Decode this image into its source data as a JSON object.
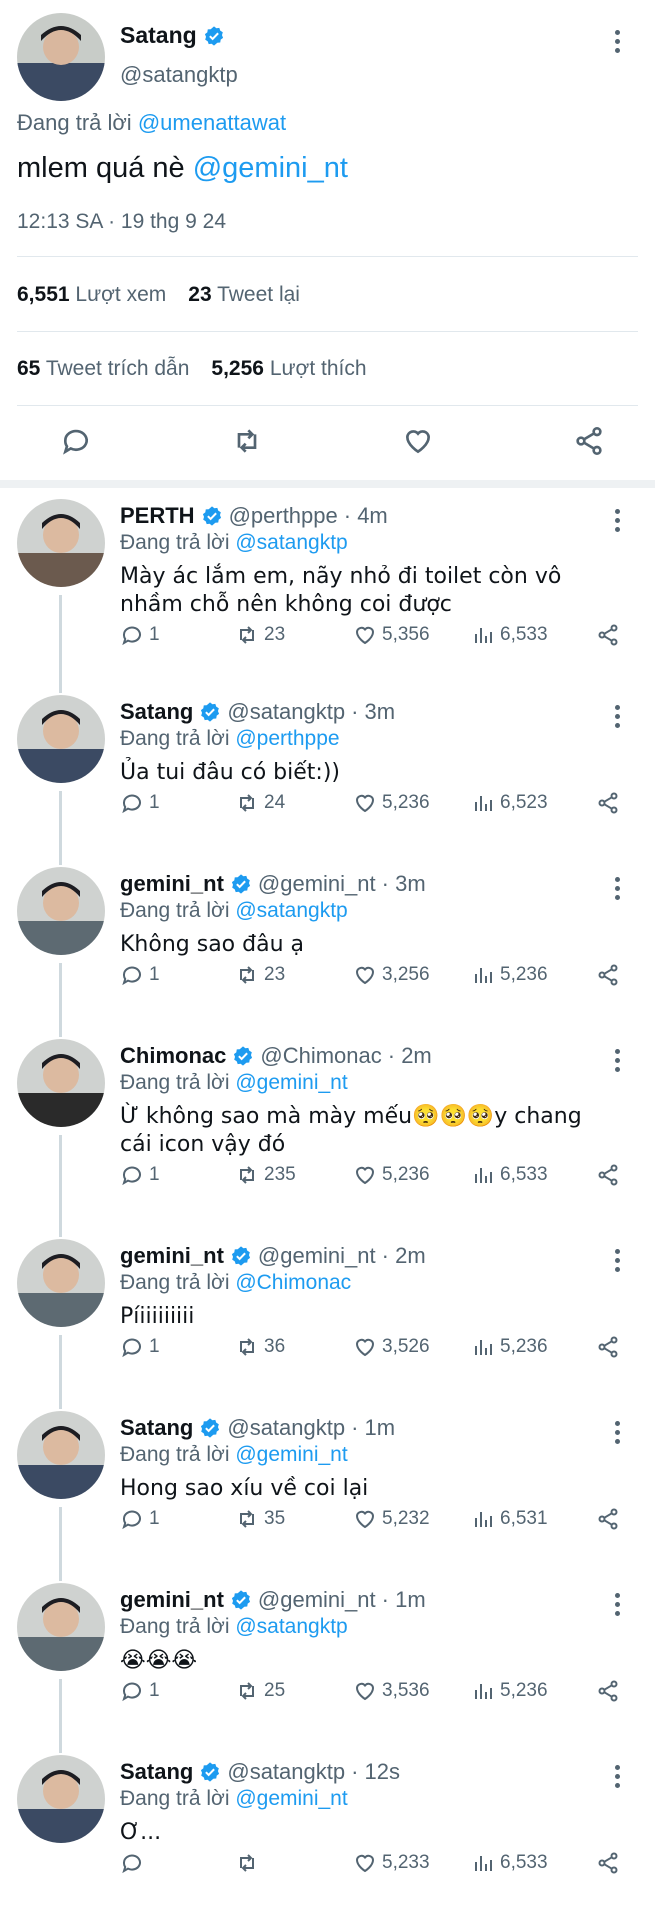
{
  "main": {
    "name": "Satang",
    "handle": "@satangktp",
    "reply_prefix": "Đang trả lời",
    "reply_to": "@umenattawat",
    "text": "mlem quá nè",
    "mention": "@gemini_nt",
    "timestamp": "12:13 SA · 19 thg 9 24",
    "views_count": "6,551",
    "views_label": "Lượt xem",
    "retweets_count": "23",
    "retweets_label": "Tweet lại",
    "quotes_count": "65",
    "quotes_label": "Tweet trích dẫn",
    "likes_count": "5,256",
    "likes_label": "Lượt thích"
  },
  "reply_prefix": "Đang trả lời",
  "replies": [
    {
      "name": "PERTH",
      "handle": "@perthppe",
      "time": "· 4m",
      "reply_to": "@satangktp",
      "text": "Mày ác lắm em, nãy nhỏ đi toilet còn vô nhầm chỗ nên không coi được",
      "replies": "1",
      "retweets": "23",
      "likes": "5,356",
      "views": "6,533",
      "avatar_color": "#6b5a4e"
    },
    {
      "name": "Satang",
      "handle": "@satangktp",
      "time": "· 3m",
      "reply_to": "@perthppe",
      "text": "Ủa tui đâu có biết:))",
      "replies": "1",
      "retweets": "24",
      "likes": "5,236",
      "views": "6,523",
      "avatar_color": "#3b4a63"
    },
    {
      "name": "gemini_nt",
      "handle": "@gemini_nt",
      "time": "· 3m",
      "reply_to": "@satangktp",
      "text": "Không sao đâu ạ",
      "replies": "1",
      "retweets": "23",
      "likes": "3,256",
      "views": "5,236",
      "avatar_color": "#5d6a72"
    },
    {
      "name": "Chimonac",
      "handle": "@Chimonac",
      "time": "· 2m",
      "reply_to": "@gemini_nt",
      "text": "Ừ không sao mà mày mếu🥺🥺🥺y chang cái icon vậy đó",
      "replies": "1",
      "retweets": "235",
      "likes": "5,236",
      "views": "6,533",
      "avatar_color": "#2a2a2a"
    },
    {
      "name": "gemini_nt",
      "handle": "@gemini_nt",
      "time": "· 2m",
      "reply_to": "@Chimonac",
      "text": "Píiiiiiiiii",
      "replies": "1",
      "retweets": "36",
      "likes": "3,526",
      "views": "5,236",
      "avatar_color": "#5d6a72"
    },
    {
      "name": "Satang",
      "handle": "@satangktp",
      "time": "· 1m",
      "reply_to": "@gemini_nt",
      "text": "Hong sao xíu về coi lại",
      "replies": "1",
      "retweets": "35",
      "likes": "5,232",
      "views": "6,531",
      "avatar_color": "#3b4a63"
    },
    {
      "name": "gemini_nt",
      "handle": "@gemini_nt",
      "time": "· 1m",
      "reply_to": "@satangktp",
      "text": "😭😭😭",
      "replies": "1",
      "retweets": "25",
      "likes": "3,536",
      "views": "5,236",
      "avatar_color": "#5d6a72"
    },
    {
      "name": "Satang",
      "handle": "@satangktp",
      "time": "· 12s",
      "reply_to": "@gemini_nt",
      "text": "Ơ...",
      "replies": "",
      "retweets": "",
      "likes": "5,233",
      "views": "6,533",
      "avatar_color": "#3b4a63"
    }
  ],
  "icons": {
    "verified": "verified-badge-icon",
    "more": "more-options-icon",
    "reply": "reply-icon",
    "retweet": "retweet-icon",
    "like": "heart-icon",
    "views": "views-icon",
    "share": "share-icon"
  },
  "colors": {
    "accent": "#1d9bf0",
    "text": "#0f1419",
    "muted": "#536471"
  }
}
